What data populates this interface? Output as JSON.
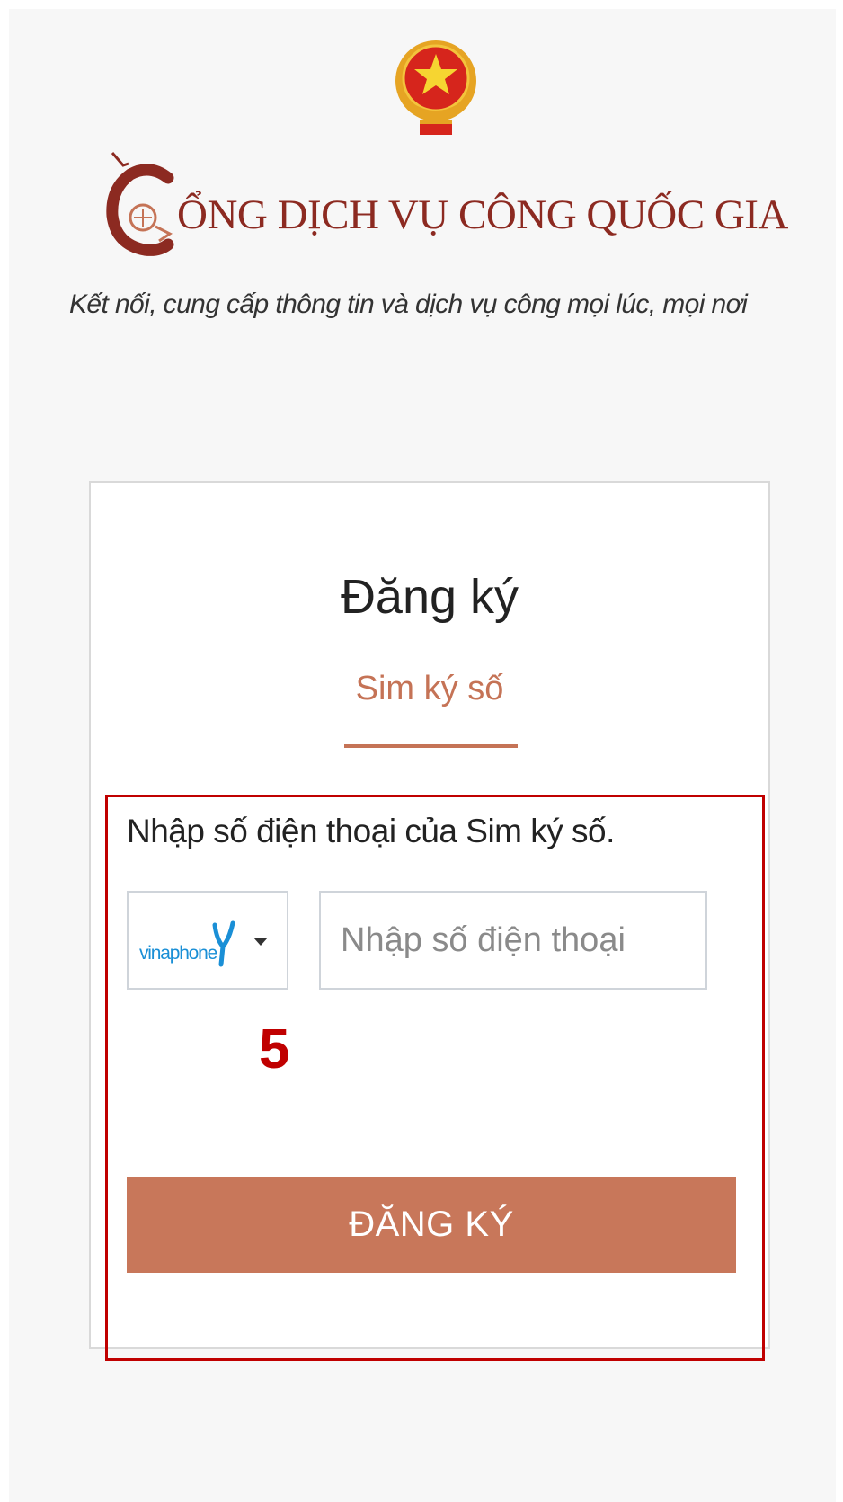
{
  "header": {
    "emblem_icon": "national-emblem-icon",
    "brand_logo_icon": "crane-c-logo-icon",
    "brand_title": "ỔNG DỊCH VỤ CÔNG QUỐC GIA",
    "slogan": "Kết nối, cung cấp thông tin và dịch vụ công mọi lúc, mọi nơi"
  },
  "card": {
    "title": "Đăng ký",
    "tab": {
      "label": "Sim ký số",
      "active": true
    },
    "instruction": "Nhập số điện thoại của Sim ký số.",
    "carrier_select": {
      "selected": "vinaphone",
      "caret_icon": "caret-down-icon"
    },
    "phone_input": {
      "value": "",
      "placeholder": "Nhập số điện thoại"
    },
    "annotation_number": "5",
    "submit_label": "ĐĂNG KÝ"
  },
  "colors": {
    "brand_red": "#8c2a21",
    "accent": "#c8775a",
    "highlight_red": "#c00000",
    "background": "#f7f7f7",
    "vinaphone_blue": "#1a8fd6"
  }
}
